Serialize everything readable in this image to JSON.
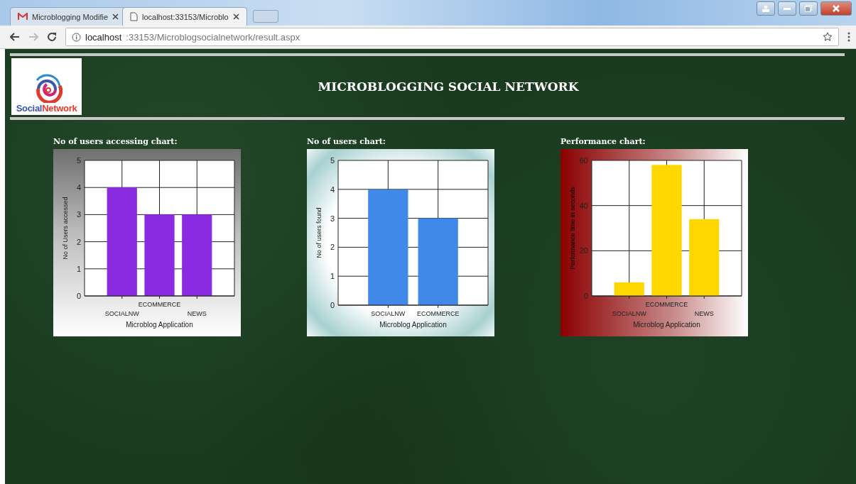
{
  "browser": {
    "tabs": [
      {
        "label": "Microblogging Modifie",
        "selected": false,
        "kind": "mail"
      },
      {
        "label": "localhost:33153/Microblo",
        "selected": true,
        "kind": "page"
      }
    ],
    "address": {
      "host": "localhost",
      "path": ":33153/Microblogsocialnetwork/result.aspx"
    }
  },
  "header": {
    "logo": {
      "parts": [
        "Social",
        "Network"
      ]
    },
    "title": "MICROBLOGGING SOCIAL NETWORK"
  },
  "charts": [
    {
      "title": "No of users accessing chart:",
      "kind": "gray",
      "chart_data": {
        "type": "bar",
        "xlabel": "Microblog Application",
        "ylabel": "No of Users accessed",
        "categories": [
          "SOCIALNW",
          "ECOMMERCE",
          "NEWS"
        ],
        "series": [
          {
            "color": "#8a2be2",
            "values": [
              4,
              3,
              3
            ]
          }
        ],
        "ylim": [
          0,
          5
        ],
        "yticks": [
          0,
          1,
          2,
          3,
          4,
          5
        ],
        "grid": true
      }
    },
    {
      "title": "No of users chart:",
      "kind": "teal",
      "chart_data": {
        "type": "bar",
        "xlabel": "Microblog Application",
        "ylabel": "No of users found",
        "categories": [
          "SOCIALNW",
          "ECOMMERCE"
        ],
        "series": [
          {
            "color": "#4189e8",
            "values": [
              4,
              3
            ]
          }
        ],
        "ylim": [
          0,
          5
        ],
        "yticks": [
          0,
          1,
          2,
          3,
          4,
          5
        ],
        "grid": true
      }
    },
    {
      "title": "Performance chart:",
      "kind": "red",
      "chart_data": {
        "type": "bar",
        "xlabel": "Microblog Application",
        "ylabel": "Performance time in seconds",
        "categories": [
          "SOCIALNW",
          "ECOMMERCE",
          "NEWS"
        ],
        "series": [
          {
            "color": "#ffd700",
            "values": [
              6,
              58,
              34
            ]
          }
        ],
        "ylim": [
          0,
          60
        ],
        "yticks": [
          0,
          20,
          40,
          60
        ],
        "grid": true
      }
    }
  ]
}
